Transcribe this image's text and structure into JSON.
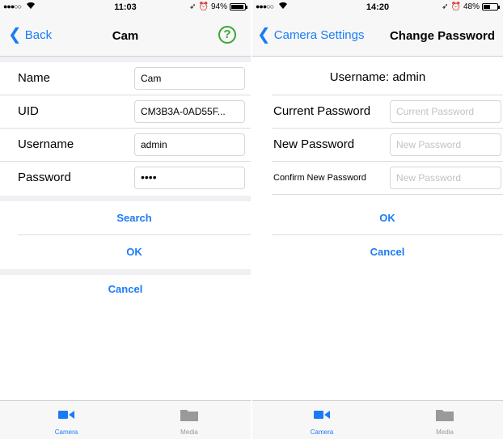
{
  "left": {
    "status": {
      "time": "11:03",
      "battery": "94%",
      "battery_level": 0.94
    },
    "nav": {
      "back_label": "Back",
      "title": "Cam",
      "help_symbol": "?"
    },
    "form": {
      "rows": [
        {
          "label": "Name",
          "value": "Cam"
        },
        {
          "label": "UID",
          "value": "CM3B3A-0AD55F..."
        },
        {
          "label": "Username",
          "value": "admin"
        },
        {
          "label": "Password",
          "value": "••••"
        }
      ]
    },
    "actions": {
      "search": "Search",
      "ok": "OK",
      "cancel": "Cancel"
    },
    "tabs": [
      {
        "label": "Camera",
        "icon": "video-camera-icon"
      },
      {
        "label": "Media",
        "icon": "folder-icon"
      }
    ]
  },
  "right": {
    "status": {
      "time": "14:20",
      "battery": "48%",
      "battery_level": 0.48
    },
    "nav": {
      "back_label": "Camera Settings",
      "title": "Change Password"
    },
    "username_line": "Username: admin",
    "form": {
      "rows": [
        {
          "label": "Current Password",
          "placeholder": "Current Password"
        },
        {
          "label": "New Password",
          "placeholder": "New Password"
        },
        {
          "label": "Confirm New Password",
          "placeholder": "New Password"
        }
      ]
    },
    "actions": {
      "ok": "OK",
      "cancel": "Cancel"
    },
    "tabs": [
      {
        "label": "Camera",
        "icon": "video-camera-icon"
      },
      {
        "label": "Media",
        "icon": "folder-icon"
      }
    ]
  },
  "colors": {
    "accent": "#1a7cf5",
    "help_green": "#3aa535",
    "group_gap": "#efeff4"
  }
}
